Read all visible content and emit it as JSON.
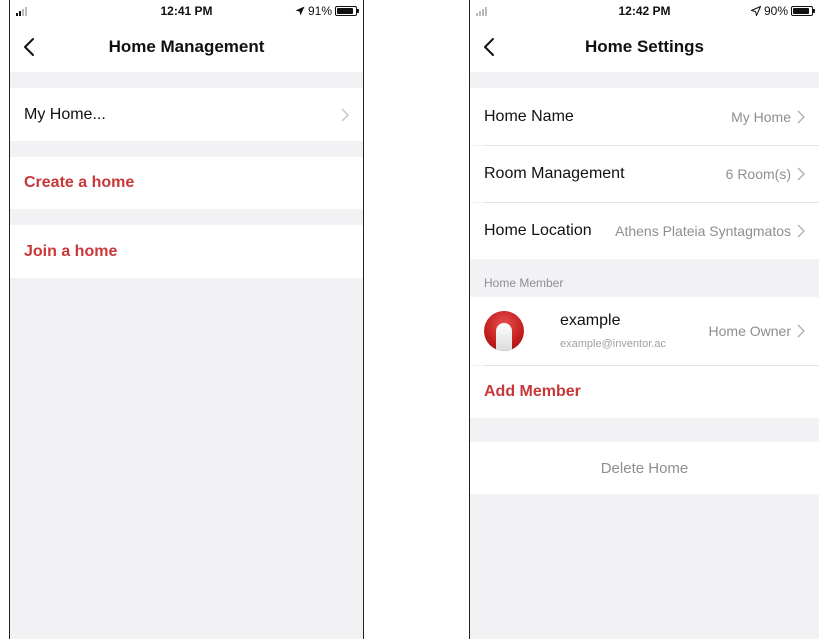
{
  "left": {
    "status": {
      "time": "12:41 PM",
      "battery": "91%",
      "battery_level": 0.91
    },
    "nav": {
      "title": "Home Management"
    },
    "rows": {
      "home": "My Home...",
      "create": "Create a home",
      "join": "Join a home"
    }
  },
  "right": {
    "status": {
      "time": "12:42 PM",
      "battery": "90%",
      "battery_level": 0.9
    },
    "nav": {
      "title": "Home Settings"
    },
    "home_name": {
      "label": "Home Name",
      "value": "My Home"
    },
    "room_management": {
      "label": "Room Management",
      "value": "6 Room(s)"
    },
    "home_location": {
      "label": "Home Location",
      "value": "Athens Plateia Syntagmatos"
    },
    "member_section_label": "Home Member",
    "member": {
      "name": "example",
      "email": "example@inventor.ac",
      "role": "Home Owner"
    },
    "add_member": "Add Member",
    "delete_home": "Delete Home"
  },
  "colors": {
    "accent_red": "#c8383a",
    "background": "#f2f2f4",
    "secondary_text": "#8e8e93"
  },
  "icons": [
    "back-chevron-icon",
    "chevron-right-icon",
    "signal-icon",
    "location-arrow-icon",
    "battery-icon",
    "avatar"
  ]
}
